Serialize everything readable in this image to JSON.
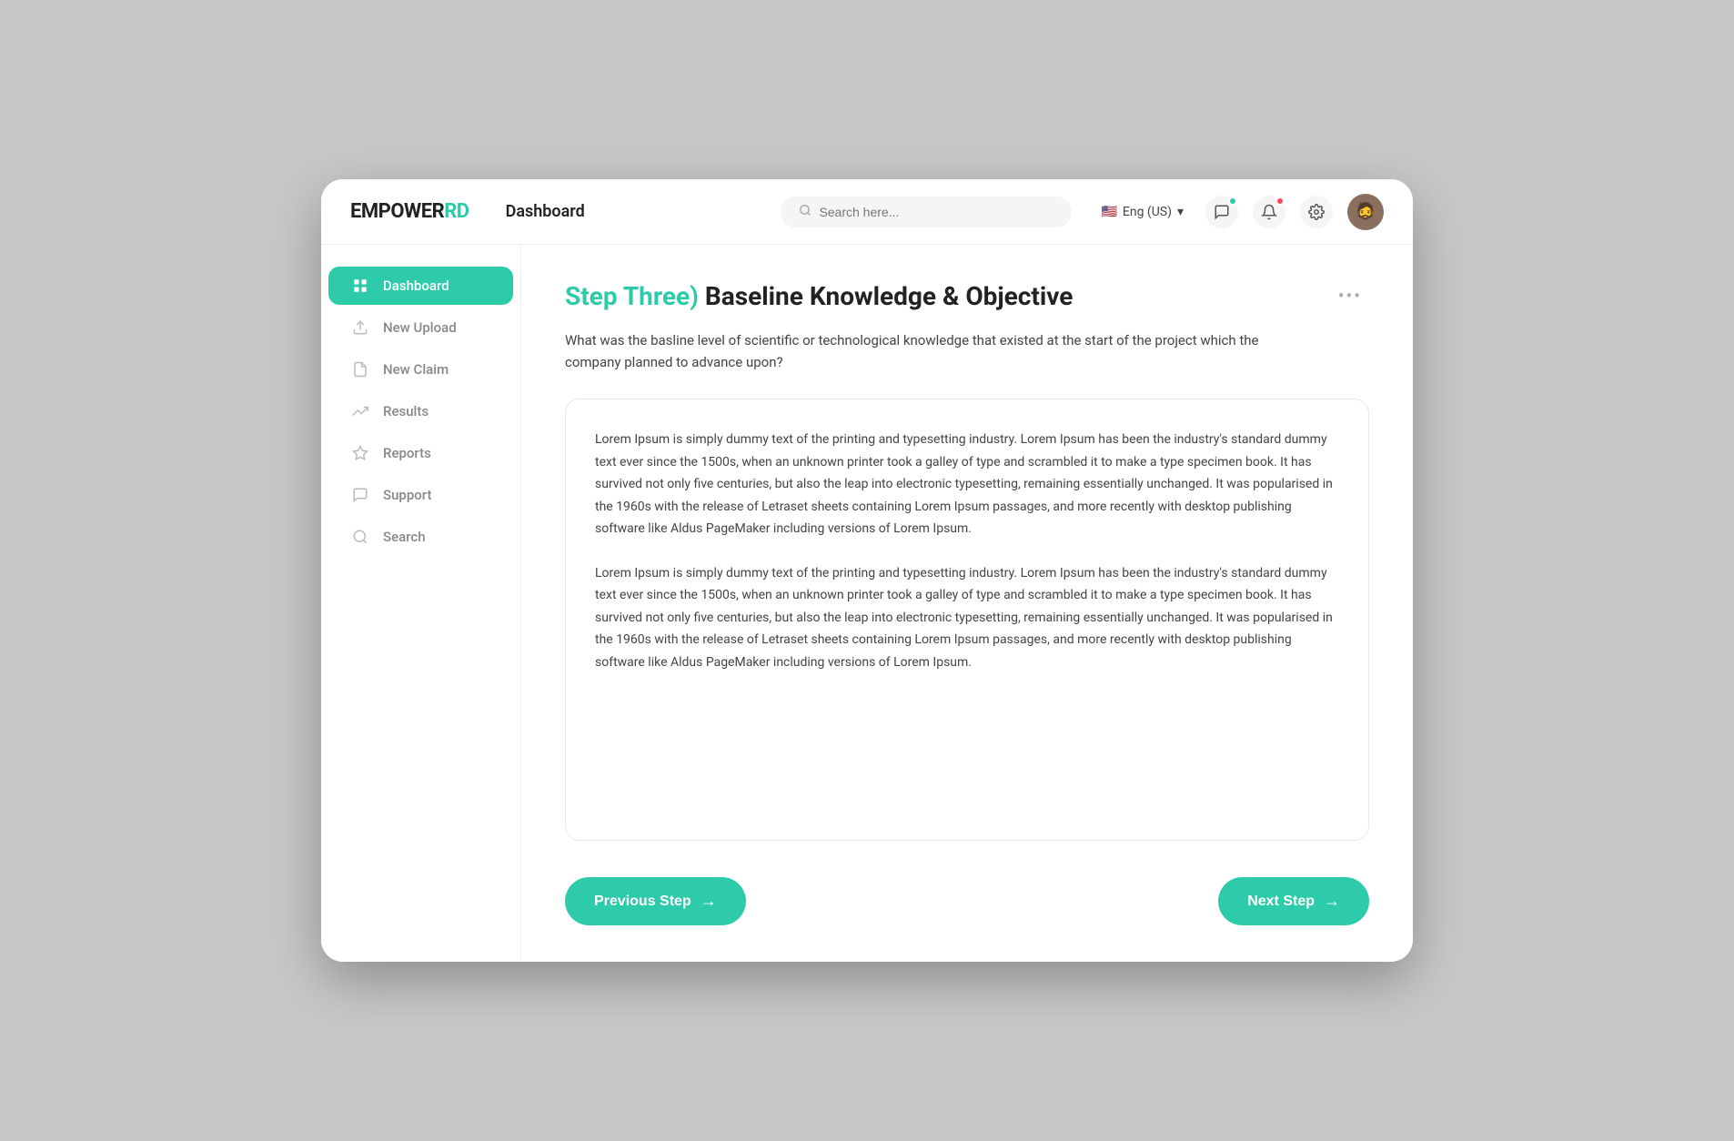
{
  "app": {
    "logo_empower": "EMPOWER",
    "logo_rd": "RD",
    "header_title": "Dashboard"
  },
  "header": {
    "search_placeholder": "Search here...",
    "language": "Eng (US)",
    "chevron": "▾"
  },
  "sidebar": {
    "items": [
      {
        "id": "dashboard",
        "label": "Dashboard",
        "active": true,
        "icon": "grid"
      },
      {
        "id": "new-upload",
        "label": "New Upload",
        "active": false,
        "icon": "upload"
      },
      {
        "id": "new-claim",
        "label": "New Claim",
        "active": false,
        "icon": "file"
      },
      {
        "id": "results",
        "label": "Results",
        "active": false,
        "icon": "chart"
      },
      {
        "id": "reports",
        "label": "Reports",
        "active": false,
        "icon": "star"
      },
      {
        "id": "support",
        "label": "Support",
        "active": false,
        "icon": "chat"
      },
      {
        "id": "search",
        "label": "Search",
        "active": false,
        "icon": "search"
      }
    ]
  },
  "main": {
    "step_label": "Step Three)",
    "step_title": " Baseline Knowledge & Objective",
    "question": "What was the basline level of scientific  or technological knowledge that existed at the start of the project which the company planned to advance upon?",
    "lorem_paragraph_1": "Lorem Ipsum is simply dummy text of the printing and typesetting industry. Lorem Ipsum has been the industry's standard dummy text ever since the 1500s, when an unknown printer took a galley of type and scrambled it to make a type specimen book. It has survived not only five centuries, but also the leap into electronic typesetting, remaining essentially unchanged. It was popularised in the 1960s with the release of Letraset sheets containing Lorem Ipsum passages, and more recently with desktop publishing software like Aldus PageMaker including versions of Lorem Ipsum.",
    "lorem_paragraph_2": "Lorem Ipsum is simply dummy text of the printing and typesetting industry. Lorem Ipsum has been the industry's standard dummy text ever since the 1500s, when an unknown printer took a galley of type and scrambled it to make a type specimen book. It has survived not only five centuries, but also the leap into electronic typesetting, remaining essentially unchanged. It was popularised in the 1960s with the release of Letraset sheets containing Lorem Ipsum passages, and more recently with desktop publishing software like Aldus PageMaker including versions of Lorem Ipsum.",
    "more_icon": "•••",
    "prev_btn_label": "Previous Step",
    "next_btn_label": "Next Step",
    "arrow": "→"
  },
  "colors": {
    "accent": "#2ecbab",
    "text_dark": "#222222",
    "text_muted": "#888888"
  }
}
